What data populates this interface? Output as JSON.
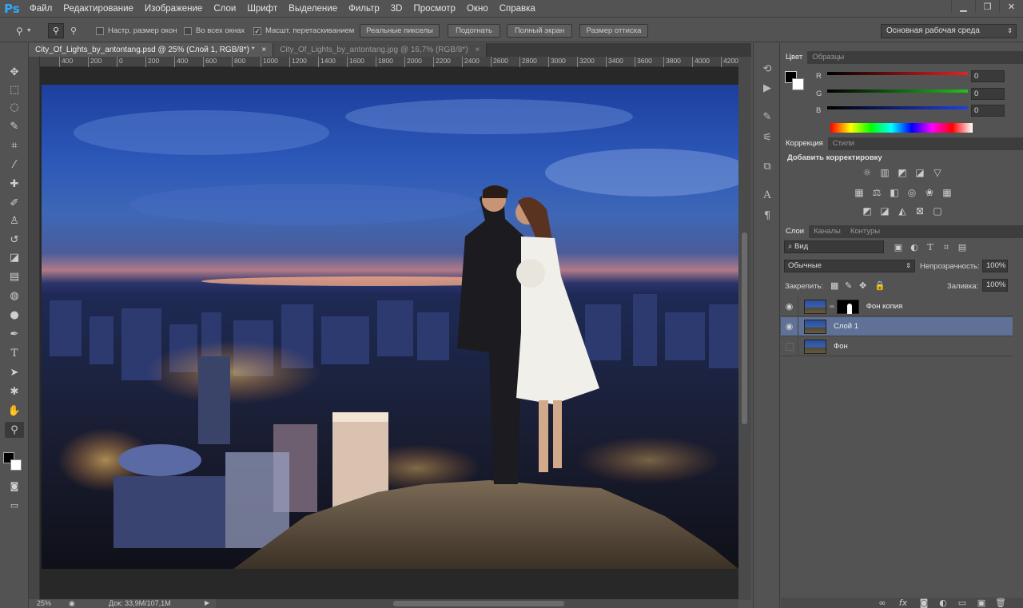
{
  "app": {
    "logo": "Ps"
  },
  "menu": [
    "Файл",
    "Редактирование",
    "Изображение",
    "Слои",
    "Шрифт",
    "Выделение",
    "Фильтр",
    "3D",
    "Просмотр",
    "Окно",
    "Справка"
  ],
  "window_controls": {
    "minimize": "▁",
    "restore": "❐",
    "close": "✕"
  },
  "options_bar": {
    "resize_windows": "Настр. размер окон",
    "all_windows": "Во всех окнах",
    "scrubby_zoom": "Масшт. перетаскиванием",
    "scrubby_zoom_checked": true,
    "actual_pixels": "Реальные пикселы",
    "fit_screen": "Подогнать",
    "fill_screen": "Полный экран",
    "print_size": "Размер оттиска",
    "workspace": "Основная рабочая среда"
  },
  "tabs": [
    {
      "label": "City_Of_Lights_by_antontang.psd @ 25% (Слой 1, RGB/8*) *",
      "close": "×"
    },
    {
      "label": "City_Of_Lights_by_antontang.jpg @ 16,7% (RGB/8*)",
      "close": "×"
    }
  ],
  "ruler_ticks": [
    "400",
    "200",
    "0",
    "200",
    "400",
    "600",
    "800",
    "1000",
    "1200",
    "1400",
    "1600",
    "1800",
    "2000",
    "2200",
    "2400",
    "2600",
    "2800",
    "3000",
    "3200",
    "3400",
    "3600",
    "3800",
    "4000",
    "4200"
  ],
  "status": {
    "zoom": "25%",
    "doc": "Док: 33,9M/107,1M"
  },
  "color_panel": {
    "tabs": [
      "Цвет",
      "Образцы"
    ],
    "channels": [
      {
        "label": "R",
        "value": "0",
        "color": "#e82020"
      },
      {
        "label": "G",
        "value": "0",
        "color": "#20c020"
      },
      {
        "label": "B",
        "value": "0",
        "color": "#2040e0"
      }
    ]
  },
  "adjustments_panel": {
    "tabs": [
      "Коррекция",
      "Стили"
    ],
    "title": "Добавить корректировку"
  },
  "layers_panel": {
    "tabs": [
      "Слои",
      "Каналы",
      "Контуры"
    ],
    "filter": "Вид",
    "blend_mode": "Обычные",
    "opacity_label": "Непрозрачность:",
    "opacity": "100%",
    "lock_label": "Закрепить:",
    "fill_label": "Заливка:",
    "fill": "100%",
    "layers": [
      {
        "name": "Фон копия",
        "visible": true,
        "mask": true,
        "selected": false
      },
      {
        "name": "Слой 1",
        "visible": true,
        "mask": false,
        "selected": true
      },
      {
        "name": "Фон",
        "visible": false,
        "mask": false,
        "selected": false
      }
    ]
  }
}
